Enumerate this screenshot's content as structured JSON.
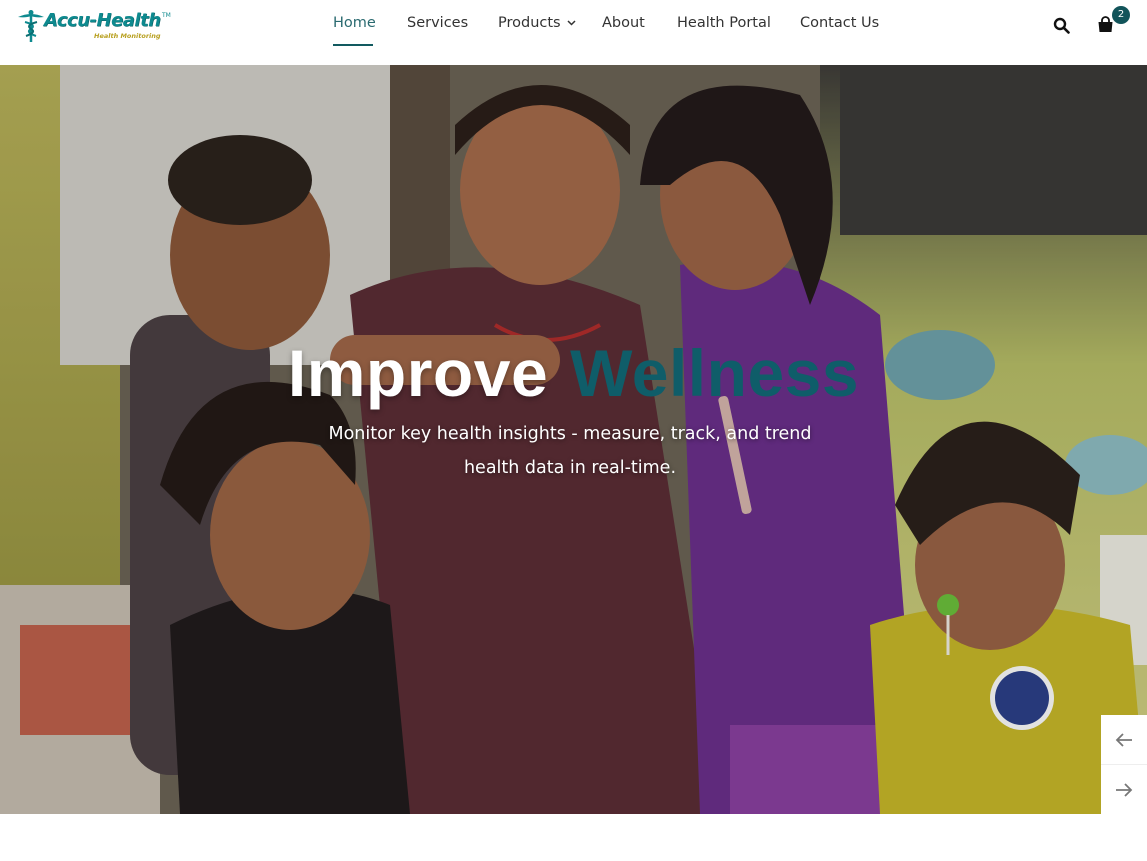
{
  "brand": {
    "name": "Accu-Health",
    "tagline": "Health Monitoring",
    "accent": "#0e8a8f",
    "dark_accent": "#125a60"
  },
  "nav": {
    "items": [
      {
        "label": "Home",
        "active": true
      },
      {
        "label": "Services"
      },
      {
        "label": "Products",
        "has_dropdown": true
      },
      {
        "label": "About"
      },
      {
        "label": "Health Portal"
      },
      {
        "label": "Contact Us"
      }
    ]
  },
  "header_actions": {
    "search_icon": "search-icon",
    "cart_icon": "shopping-bag-icon",
    "cart_count": "2"
  },
  "hero": {
    "title_part1": "Improve",
    "title_part2": "Wellness",
    "subtitle_line1": "Monitor key health insights - measure, track, and trend",
    "subtitle_line2": "health data in real-time.",
    "prev_icon": "arrow-left-icon",
    "next_icon": "arrow-right-icon"
  }
}
